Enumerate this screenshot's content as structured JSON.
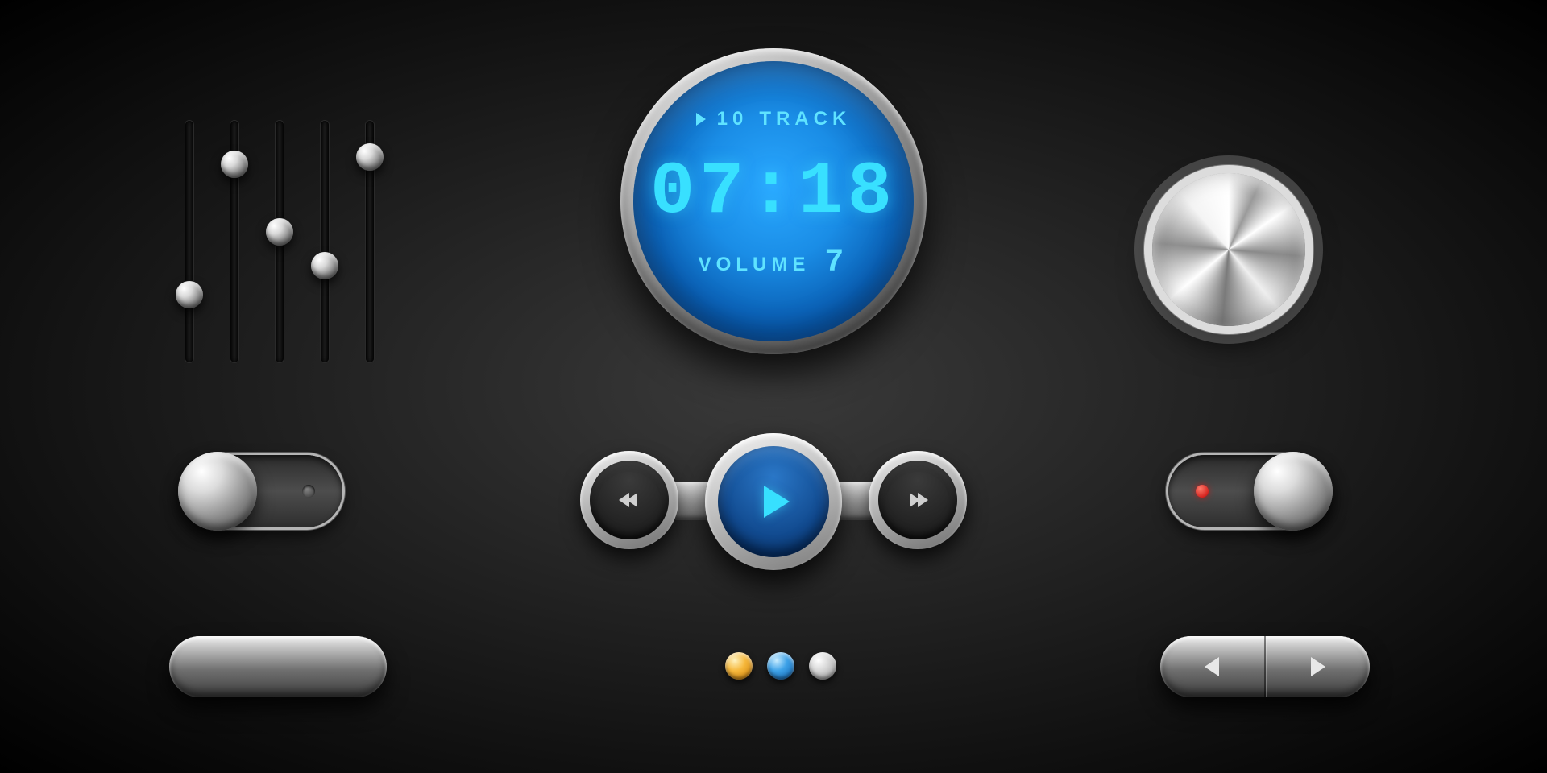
{
  "equalizer": {
    "bands": [
      {
        "position_pct": 72
      },
      {
        "position_pct": 18
      },
      {
        "position_pct": 46
      },
      {
        "position_pct": 60
      },
      {
        "position_pct": 15
      }
    ]
  },
  "display": {
    "status_icon": "play",
    "track_number": "10",
    "track_label": "TRACK",
    "time": "07:18",
    "volume_label": "VOLUME",
    "volume_value": "7"
  },
  "knob": {
    "name": "jog-dial"
  },
  "toggles": {
    "left": {
      "state": "off",
      "indicator_color": "#555"
    },
    "right": {
      "state": "on",
      "indicator_color": "#e01b1b"
    }
  },
  "transport": {
    "prev_icon": "double-chevron-left",
    "play_icon": "play",
    "next_icon": "double-chevron-right"
  },
  "indicator_dots": [
    {
      "color_name": "amber"
    },
    {
      "color_name": "blue"
    },
    {
      "color_name": "silver"
    }
  ],
  "pill_button": {
    "label": ""
  },
  "segmented": {
    "left_icon": "triangle-left",
    "right_icon": "triangle-right"
  },
  "colors": {
    "lcd_text": "#5fe3ff",
    "lcd_time": "#38e0ff",
    "play_face": "#114a8f"
  }
}
